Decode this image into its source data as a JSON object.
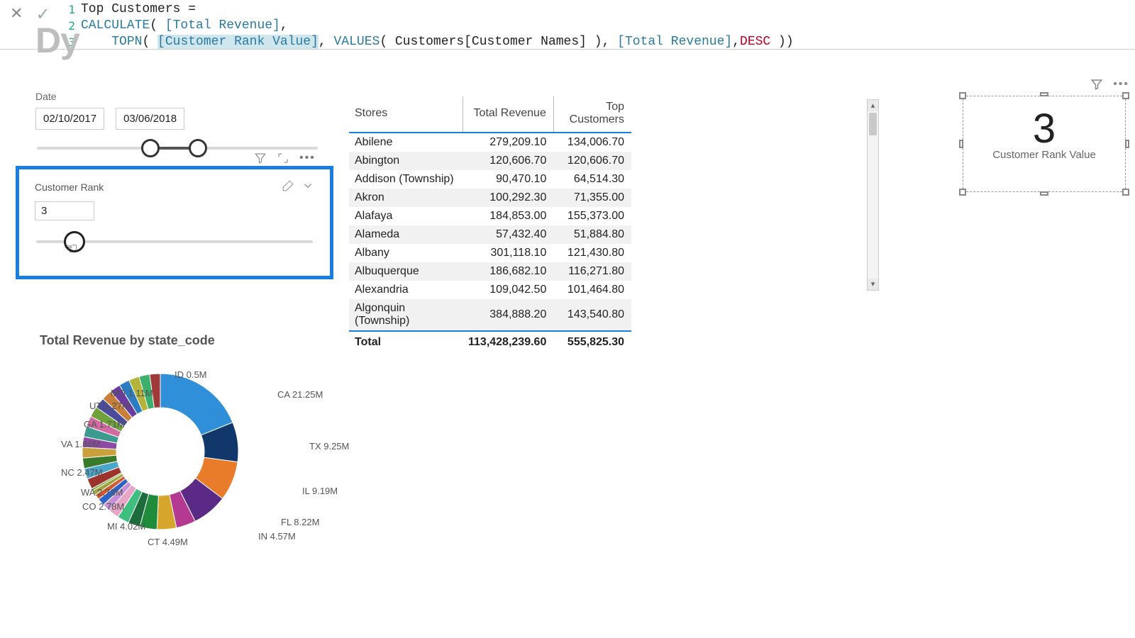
{
  "formula": {
    "line1_lnum": "1",
    "line1_a": "Top Customers ",
    "line1_b": "=",
    "line2_lnum": "2",
    "line2_a": "CALCULATE",
    "line2_b": "( ",
    "line2_c": "[Total Revenue]",
    "line2_d": ",",
    "line3_lnum": "3",
    "line3_pad": "    ",
    "line3_a": "TOPN",
    "line3_b": "( ",
    "line3_sel": "[Customer Rank Value]",
    "line3_c": ", ",
    "line3_d": "VALUES",
    "line3_e": "( Customers[Customer Names] ), ",
    "line3_f": "[Total Revenue]",
    "line3_g": ",",
    "line3_h": "DESC",
    "line3_i": " ))"
  },
  "page_title_fragment": "Dy",
  "date_slicer": {
    "label": "Date",
    "from": "02/10/2017",
    "to": "03/06/2018"
  },
  "rank_slicer": {
    "label": "Customer Rank",
    "value": "3"
  },
  "table": {
    "headers": {
      "c1": "Stores",
      "c2": "Total Revenue",
      "c3": "Top Customers"
    },
    "rows": [
      {
        "c1": "Abilene",
        "c2": "279,209.10",
        "c3": "134,006.70"
      },
      {
        "c1": "Abington",
        "c2": "120,606.70",
        "c3": "120,606.70"
      },
      {
        "c1": "Addison (Township)",
        "c2": "90,470.10",
        "c3": "64,514.30"
      },
      {
        "c1": "Akron",
        "c2": "100,292.30",
        "c3": "71,355.00"
      },
      {
        "c1": "Alafaya",
        "c2": "184,853.00",
        "c3": "155,373.00"
      },
      {
        "c1": "Alameda",
        "c2": "57,432.40",
        "c3": "51,884.80"
      },
      {
        "c1": "Albany",
        "c2": "301,118.10",
        "c3": "121,430.80"
      },
      {
        "c1": "Albuquerque",
        "c2": "186,682.10",
        "c3": "116,271.80"
      },
      {
        "c1": "Alexandria",
        "c2": "109,042.50",
        "c3": "101,464.80"
      },
      {
        "c1": "Algonquin (Township)",
        "c2": "384,888.20",
        "c3": "143,540.80"
      }
    ],
    "total": {
      "c1": "Total",
      "c2": "113,428,239.60",
      "c3": "555,825.30"
    }
  },
  "card": {
    "value": "3",
    "label": "Customer Rank Value"
  },
  "donut": {
    "title": "Total Revenue by state_code"
  },
  "chart_data": {
    "type": "pie",
    "title": "Total Revenue by state_code",
    "unit": "M",
    "series": [
      {
        "name": "CA",
        "value": 21.25,
        "label": "CA 21.25M",
        "color": "#2f8fd9"
      },
      {
        "name": "TX",
        "value": 9.25,
        "label": "TX 9.25M",
        "color": "#12386b"
      },
      {
        "name": "IL",
        "value": 9.19,
        "label": "IL 9.19M",
        "color": "#e97c2a"
      },
      {
        "name": "FL",
        "value": 8.22,
        "label": "FL 8.22M",
        "color": "#5b2a86"
      },
      {
        "name": "IN",
        "value": 4.57,
        "label": "IN 4.57M",
        "color": "#b43a91"
      },
      {
        "name": "CT",
        "value": 4.49,
        "label": "CT 4.49M",
        "color": "#d6a52b"
      },
      {
        "name": "MI",
        "value": 4.02,
        "label": "MI 4.02M",
        "color": "#1f8c3b"
      },
      {
        "name": "CO",
        "value": 2.78,
        "label": "CO 2.78M",
        "color": "#1c6b3a"
      },
      {
        "name": "WA",
        "value": 2.73,
        "label": "WA 2.73M",
        "color": "#3fbf7f"
      },
      {
        "name": "NC",
        "value": 2.47,
        "label": "NC 2.47M",
        "color": "#e8a6c7"
      },
      {
        "name": "VA",
        "value": 1.86,
        "label": "VA 1.86M",
        "color": "#c68fd6"
      },
      {
        "name": "GA",
        "value": 1.71,
        "label": "GA 1.71M",
        "color": "#2f62c7"
      },
      {
        "name": "UT",
        "value": 1.27,
        "label": "UT 1.27M",
        "color": "#d1572e"
      },
      {
        "name": "MO",
        "value": 1.11,
        "label": "MO 1.11M",
        "color": "#9fa33a"
      },
      {
        "name": "ID",
        "value": 0.5,
        "label": "ID 0.5M",
        "color": "#73a83c"
      }
    ],
    "other_total_estimate": 37.0
  }
}
